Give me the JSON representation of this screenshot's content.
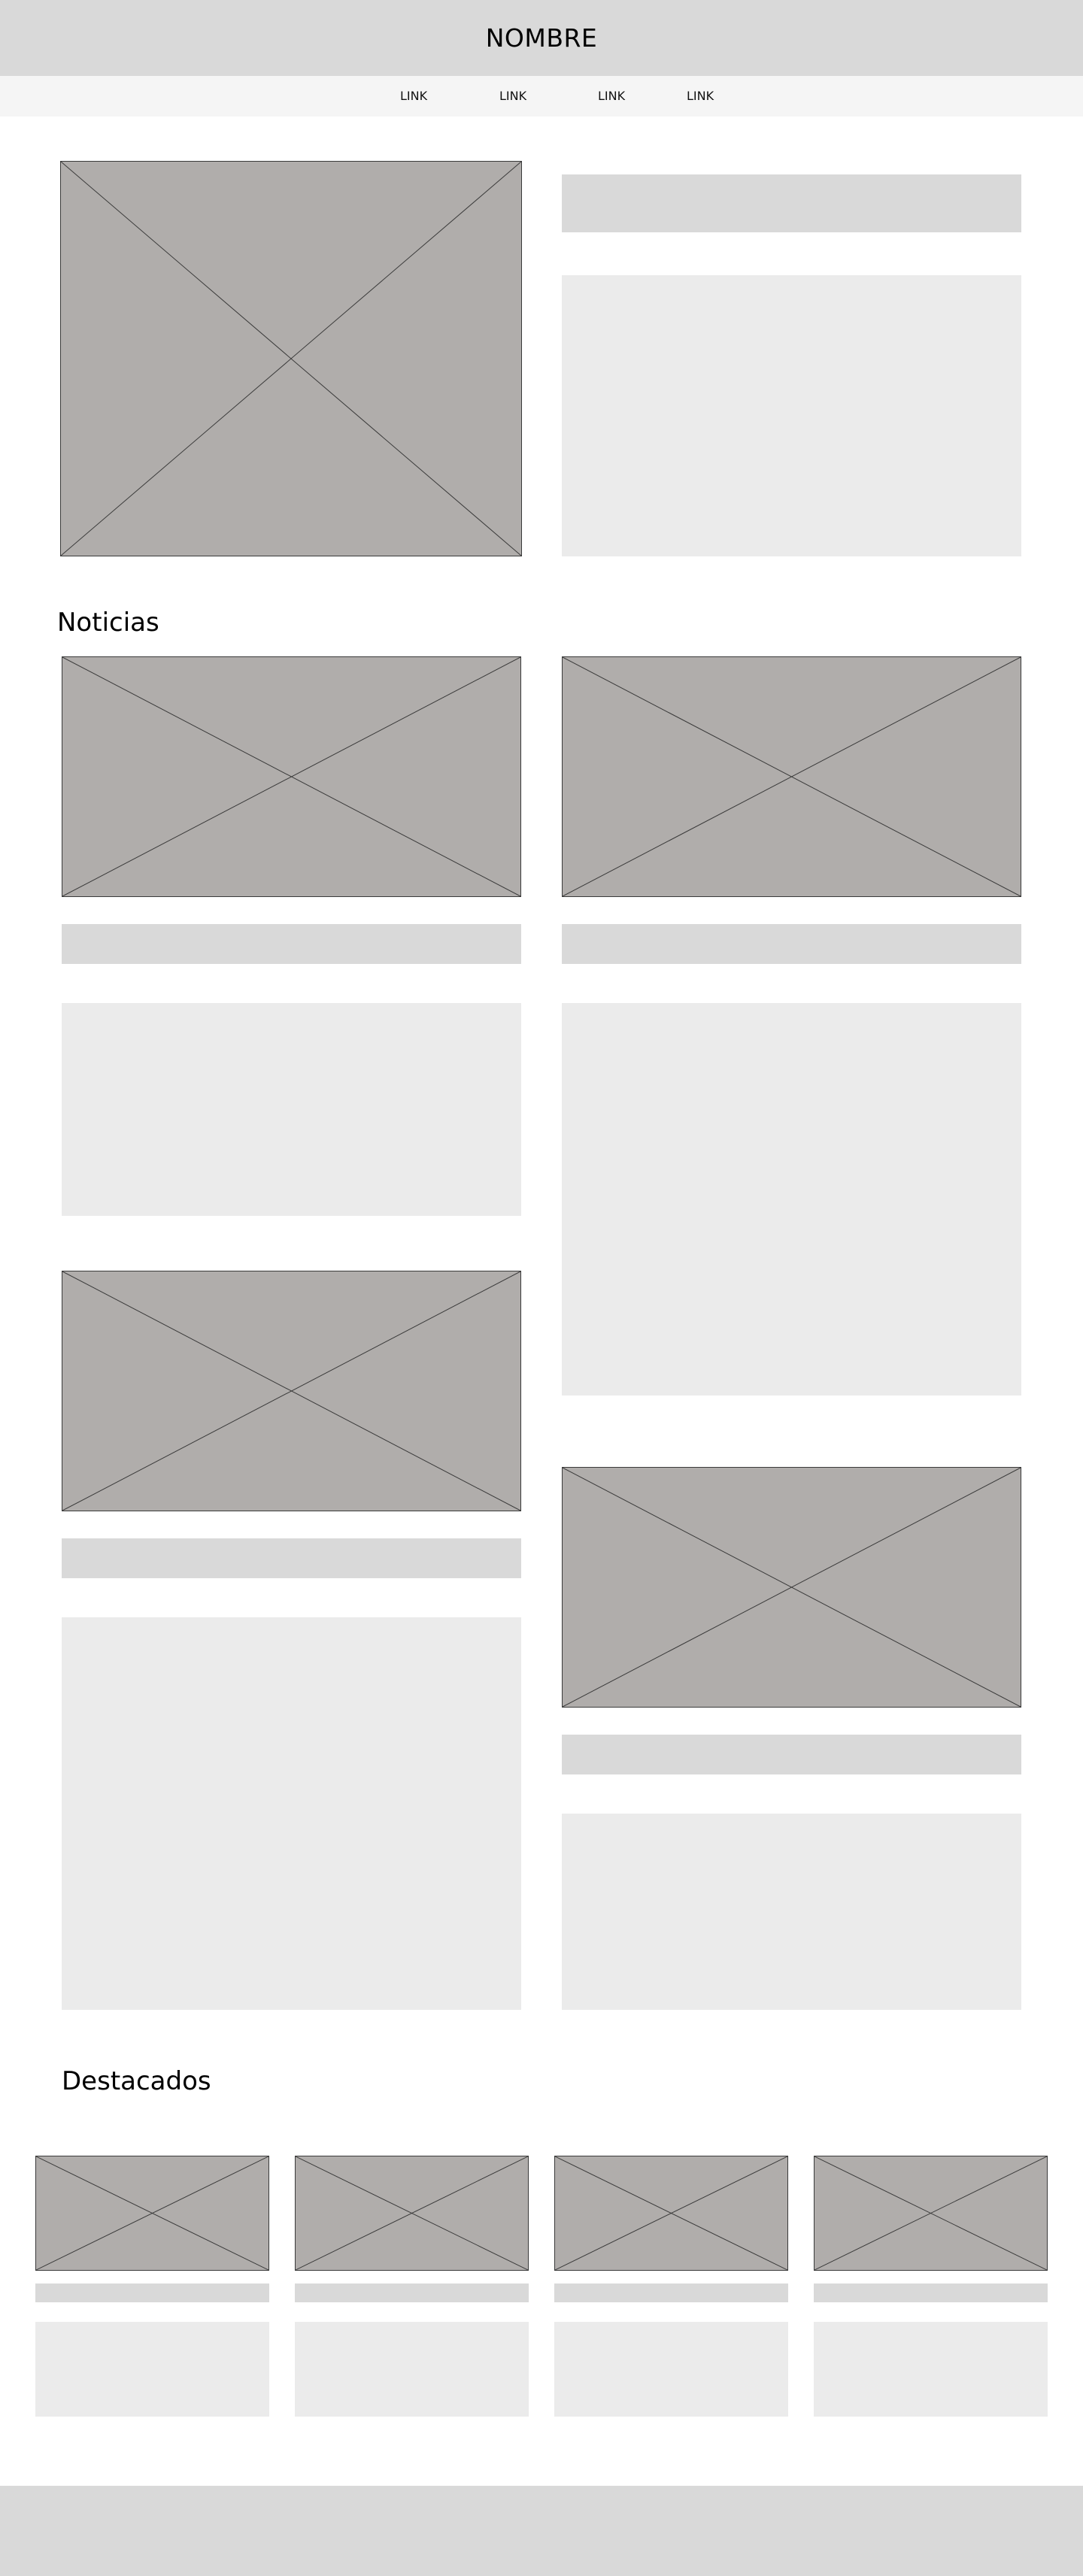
{
  "header": {
    "site_name": "NOMBRE"
  },
  "nav": {
    "links": [
      {
        "label": "LINK"
      },
      {
        "label": "LINK"
      },
      {
        "label": "LINK"
      },
      {
        "label": "LINK"
      }
    ]
  },
  "sections": {
    "news_title": "Noticias",
    "featured_title": "Destacados"
  },
  "icons": {
    "image_placeholder": "image-placeholder-icon"
  },
  "colors": {
    "header_bg": "#d9d9d9",
    "nav_bg": "#f5f5f5",
    "image_placeholder": "#b0adab",
    "title_bar": "#d9d9d9",
    "text_block": "#ebebeb",
    "footer_bg": "#d9d9d9"
  }
}
